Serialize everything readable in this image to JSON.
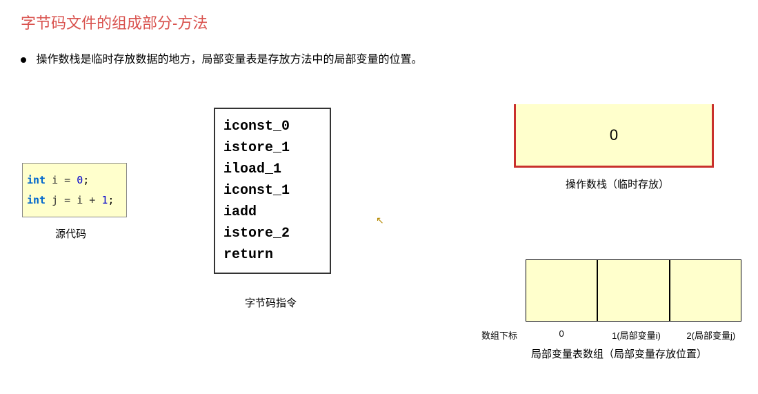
{
  "title": "字节码文件的组成部分-方法",
  "bullet": "操作数栈是临时存放数据的地方，局部变量表是存放方法中的局部变量的位置。",
  "source": {
    "line1_kw": "int",
    "line1_rest": " i = ",
    "line1_num": "0",
    "line1_semi": ";",
    "line2_kw": "int",
    "line2_rest": " j = i + ",
    "line2_num": "1",
    "line2_semi": ";",
    "label": "源代码"
  },
  "bytecode": {
    "lines": [
      "iconst_0",
      "istore_1",
      "iload_1",
      "iconst_1",
      "iadd",
      "istore_2",
      "return"
    ],
    "label": "字节码指令"
  },
  "operand_stack": {
    "value": "0",
    "label": "操作数栈（临时存放）"
  },
  "local_vars": {
    "index_label": "数组下标",
    "indices": [
      "0",
      "1(局部变量i)",
      "2(局部变量j)"
    ],
    "label": "局部变量表数组（局部变量存放位置）"
  }
}
